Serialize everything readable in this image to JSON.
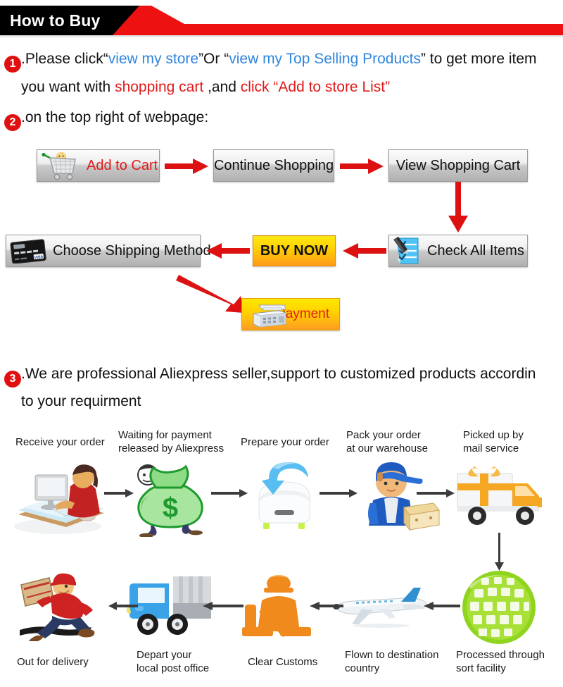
{
  "header": {
    "title": "How to Buy",
    "black": "#000000",
    "red": "#ee1111"
  },
  "steps": {
    "one": {
      "num": "1",
      "a": ".Please click“",
      "link1": "view my store",
      "b": "”Or “",
      "link2": "view my Top Selling Products",
      "c": "” to get more item",
      "line2_a": "you want with ",
      "line2_red1": "shopping cart",
      "line2_b": " ,and ",
      "line2_red2": "click “Add to store List”"
    },
    "two": {
      "num": "2",
      "text": ".on the top right of webpage:"
    },
    "three": {
      "num": "3",
      "text": ".We are professional Aliexpress seller,support to customized products accordin",
      "line2": "to your requirment"
    }
  },
  "buttons": {
    "add_to_cart": "Add to Cart",
    "continue_shopping": "Continue Shopping",
    "view_shopping_cart": "View Shopping Cart",
    "choose_shipping_method": "Choose Shipping Method",
    "buy_now": "BUY NOW",
    "check_all_items": "Check All Items",
    "payment": "Payment",
    "accent_red": "#e01a1a",
    "accent_orange": "#ff9a18"
  },
  "flow": {
    "row1": [
      {
        "label": "Receive your order",
        "icon": "person-at-computer-icon"
      },
      {
        "label": "Waiting for payment\nreleased by Aliexpress",
        "icon": "money-bag-icon"
      },
      {
        "label": "Prepare your order",
        "icon": "download-box-icon"
      },
      {
        "label": "Pack your order\nat our warehouse",
        "icon": "worker-packing-icon"
      },
      {
        "label": "Picked up by\nmail service",
        "icon": "delivery-truck-gift-icon"
      }
    ],
    "row2": [
      {
        "label": "Out for delivery",
        "icon": "running-courier-icon"
      },
      {
        "label": "Depart your\nlocal post office",
        "icon": "blue-post-truck-icon"
      },
      {
        "label": "Clear Customs",
        "icon": "customs-officer-icon"
      },
      {
        "label": "Flown to destination\ncountry",
        "icon": "airplane-icon"
      },
      {
        "label": "Processed through\nsort facility",
        "icon": "green-globe-icon"
      }
    ]
  }
}
